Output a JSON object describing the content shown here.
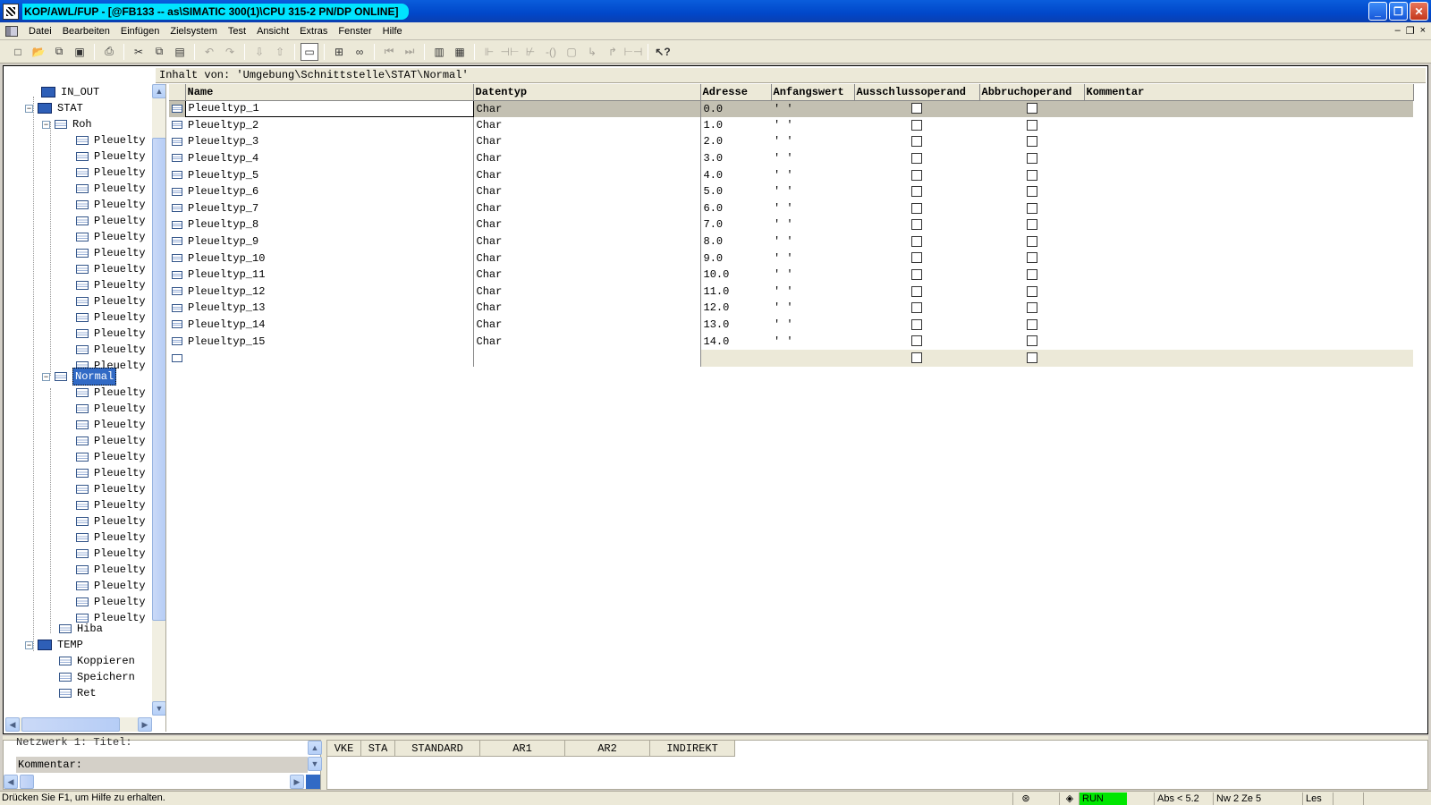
{
  "window": {
    "title": "KOP/AWL/FUP  - [@FB133 -- as\\SIMATIC 300(1)\\CPU 315-2 PN/DP  ONLINE]",
    "buttons": {
      "minimize": "_",
      "restore": "❐",
      "close": "✕"
    }
  },
  "menu": {
    "items": [
      "Datei",
      "Bearbeiten",
      "Einfügen",
      "Zielsystem",
      "Test",
      "Ansicht",
      "Extras",
      "Fenster",
      "Hilfe"
    ],
    "mdi": {
      "minimize": "–",
      "restore": "❐",
      "close": "×"
    }
  },
  "toolbar": {
    "icons": [
      "new-icon",
      "open-icon",
      "accessible-nodes-icon",
      "save-icon",
      "print-icon",
      "cut-icon",
      "copy-icon",
      "paste-icon",
      "undo-icon",
      "redo-icon",
      "download-icon",
      "upload-icon",
      "overview-icon",
      "network-icon",
      "monitor-icon",
      "prev-icon",
      "next-icon",
      "elements-icon",
      "details-icon",
      "branch-icon",
      "contact-no-icon",
      "contact-nc-icon",
      "coil-icon",
      "box-icon",
      "open-branch-icon",
      "close-branch-icon",
      "connection-icon",
      "help-icon"
    ]
  },
  "path": "Inhalt von: 'Umgebung\\Schnittstelle\\STAT\\Normal'",
  "tree": {
    "in_out": "IN_OUT",
    "stat": "STAT",
    "roh": "Roh",
    "roh_items": [
      "Pleuelty",
      "Pleuelty",
      "Pleuelty",
      "Pleuelty",
      "Pleuelty",
      "Pleuelty",
      "Pleuelty",
      "Pleuelty",
      "Pleuelty",
      "Pleuelty",
      "Pleuelty",
      "Pleuelty",
      "Pleuelty",
      "Pleuelty",
      "Pleuelty"
    ],
    "normal": "Normal",
    "normal_items": [
      "Pleuelty",
      "Pleuelty",
      "Pleuelty",
      "Pleuelty",
      "Pleuelty",
      "Pleuelty",
      "Pleuelty",
      "Pleuelty",
      "Pleuelty",
      "Pleuelty",
      "Pleuelty",
      "Pleuelty",
      "Pleuelty",
      "Pleuelty",
      "Pleuelty"
    ],
    "hiba": "Hiba",
    "temp": "TEMP",
    "temp_items": [
      "Koppieren",
      "Speichern",
      "Ret"
    ]
  },
  "table": {
    "headers": {
      "name": "Name",
      "datentyp": "Datentyp",
      "adresse": "Adresse",
      "anfangswert": "Anfangswert",
      "ausschluss": "Ausschlussoperand",
      "abbruch": "Abbruchoperand",
      "kommentar": "Kommentar"
    },
    "rows": [
      {
        "name": "Pleueltyp_1",
        "type": "Char",
        "addr": "0.0",
        "init": "' '"
      },
      {
        "name": "Pleueltyp_2",
        "type": "Char",
        "addr": "1.0",
        "init": "' '"
      },
      {
        "name": "Pleueltyp_3",
        "type": "Char",
        "addr": "2.0",
        "init": "' '"
      },
      {
        "name": "Pleueltyp_4",
        "type": "Char",
        "addr": "3.0",
        "init": "' '"
      },
      {
        "name": "Pleueltyp_5",
        "type": "Char",
        "addr": "4.0",
        "init": "' '"
      },
      {
        "name": "Pleueltyp_6",
        "type": "Char",
        "addr": "5.0",
        "init": "' '"
      },
      {
        "name": "Pleueltyp_7",
        "type": "Char",
        "addr": "6.0",
        "init": "' '"
      },
      {
        "name": "Pleueltyp_8",
        "type": "Char",
        "addr": "7.0",
        "init": "' '"
      },
      {
        "name": "Pleueltyp_9",
        "type": "Char",
        "addr": "8.0",
        "init": "' '"
      },
      {
        "name": "Pleueltyp_10",
        "type": "Char",
        "addr": "9.0",
        "init": "' '"
      },
      {
        "name": "Pleueltyp_11",
        "type": "Char",
        "addr": "10.0",
        "init": "' '"
      },
      {
        "name": "Pleueltyp_12",
        "type": "Char",
        "addr": "11.0",
        "init": "' '"
      },
      {
        "name": "Pleueltyp_13",
        "type": "Char",
        "addr": "12.0",
        "init": "' '"
      },
      {
        "name": "Pleueltyp_14",
        "type": "Char",
        "addr": "13.0",
        "init": "' '"
      },
      {
        "name": "Pleueltyp_15",
        "type": "Char",
        "addr": "14.0",
        "init": "' '"
      }
    ]
  },
  "bottom": {
    "netzwerk_title": "Netzwerk 1: Titel:",
    "kommentar": "Kommentar:",
    "register_cols": [
      "VKE",
      "STA",
      "STANDARD",
      "AR1",
      "AR2",
      "INDIREKT"
    ]
  },
  "status": {
    "help": "Drücken Sie F1, um Hilfe zu erhalten.",
    "run": "RUN",
    "abs": "Abs < 5.2",
    "nw": "Nw 2  Ze 5",
    "mode": "Les"
  }
}
